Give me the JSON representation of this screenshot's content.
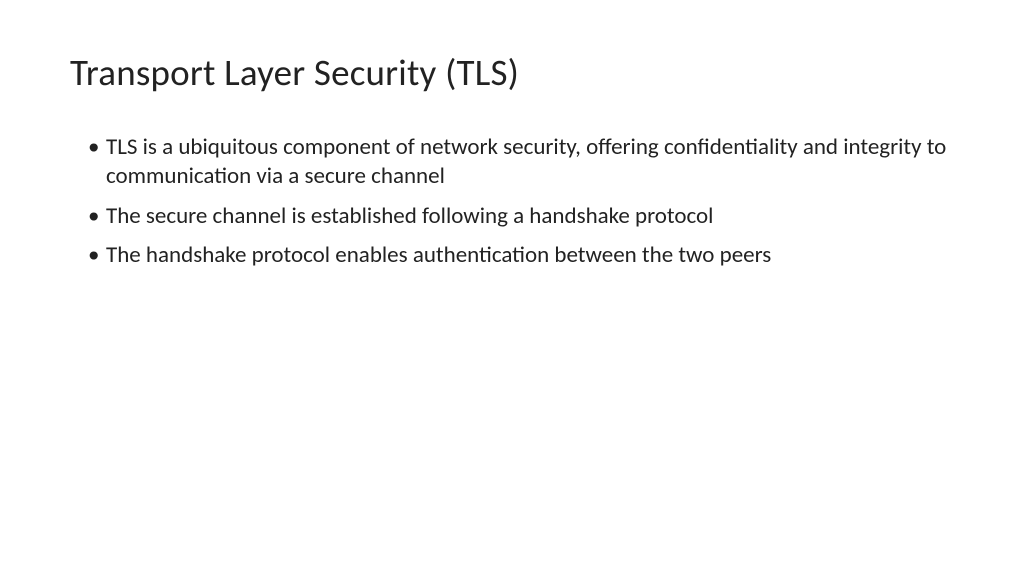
{
  "slide": {
    "title": "Transport Layer Security (TLS)",
    "bullets": [
      "TLS is a ubiquitous component of network security, offering confidentiality and integrity to communication via a secure channel",
      "The secure channel is established following a handshake protocol",
      "The handshake protocol enables authentication between the two peers"
    ]
  }
}
